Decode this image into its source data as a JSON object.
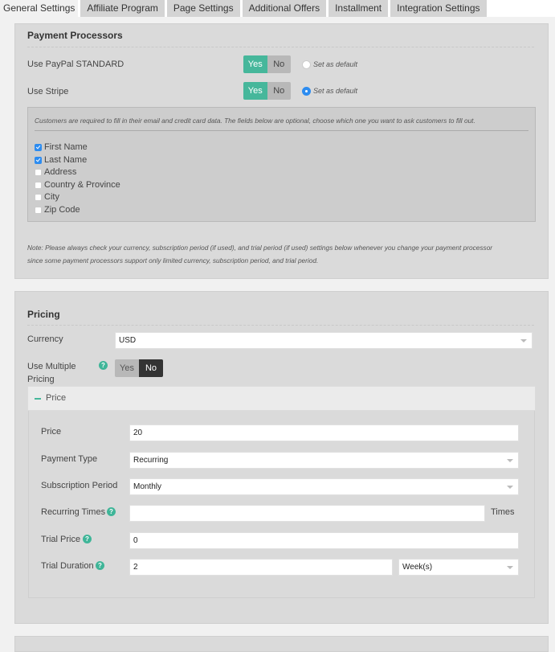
{
  "tabs": [
    {
      "label": "General Settings",
      "active": true
    },
    {
      "label": "Affiliate Program",
      "active": false
    },
    {
      "label": "Page Settings",
      "active": false
    },
    {
      "label": "Additional Offers",
      "active": false
    },
    {
      "label": "Installment",
      "active": false
    },
    {
      "label": "Integration Settings",
      "active": false
    }
  ],
  "payment_processors": {
    "title": "Payment Processors",
    "paypal": {
      "label": "Use PayPal STANDARD",
      "yes": "Yes",
      "no": "No",
      "value": "Yes",
      "default_label": "Set as default",
      "is_default": false
    },
    "stripe": {
      "label": "Use Stripe",
      "yes": "Yes",
      "no": "No",
      "value": "Yes",
      "default_label": "Set as default",
      "is_default": true
    },
    "fields_info": "Customers are required to fill in their email and credit card data. The fields below are optional, choose which one you want to ask customers to fill out.",
    "fields": [
      {
        "label": "First Name",
        "checked": true
      },
      {
        "label": "Last Name",
        "checked": true
      },
      {
        "label": "Address",
        "checked": false
      },
      {
        "label": "Country & Province",
        "checked": false
      },
      {
        "label": "City",
        "checked": false
      },
      {
        "label": "Zip Code",
        "checked": false
      }
    ],
    "note_line1": "Note: Please always check your currency, subscription period (if used), and trial period (if used) settings below whenever you change your payment processor",
    "note_line2": "since some payment processors support only limited currency, subscription period, and trial period."
  },
  "pricing": {
    "title": "Pricing",
    "currency": {
      "label": "Currency",
      "value": "USD"
    },
    "multiple_pricing": {
      "label_line1": "Use Multiple",
      "label_line2": "Pricing",
      "yes": "Yes",
      "no": "No",
      "value": "No"
    },
    "price_section": {
      "title": "Price",
      "price": {
        "label": "Price",
        "value": "20"
      },
      "payment_type": {
        "label": "Payment Type",
        "value": "Recurring"
      },
      "subscription_period": {
        "label": "Subscription Period",
        "value": "Monthly"
      },
      "recurring_times": {
        "label": "Recurring Times",
        "value": "",
        "suffix": "Times"
      },
      "trial_price": {
        "label": "Trial Price",
        "value": "0"
      },
      "trial_duration": {
        "label": "Trial Duration",
        "value": "2",
        "unit": "Week(s)"
      }
    }
  },
  "colors": {
    "accent": "#46b79b",
    "radio_selected": "#2d8cf0",
    "toggle_off_dark": "#333333"
  }
}
